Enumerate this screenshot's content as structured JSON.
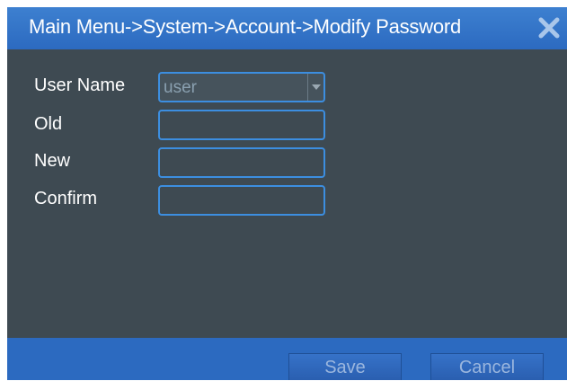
{
  "window": {
    "title": "Main Menu->System->Account->Modify Password",
    "close_icon": "close-icon"
  },
  "form": {
    "user_name_label": "User Name",
    "user_name_value": "user",
    "old_label": "Old",
    "old_value": "",
    "new_label": "New",
    "new_value": "",
    "confirm_label": "Confirm",
    "confirm_value": ""
  },
  "footer": {
    "save_label": "Save",
    "cancel_label": "Cancel"
  },
  "colors": {
    "title_bar": "#2c6ac0",
    "panel_bg": "#3e4a52",
    "field_border": "#3c8ee0"
  }
}
